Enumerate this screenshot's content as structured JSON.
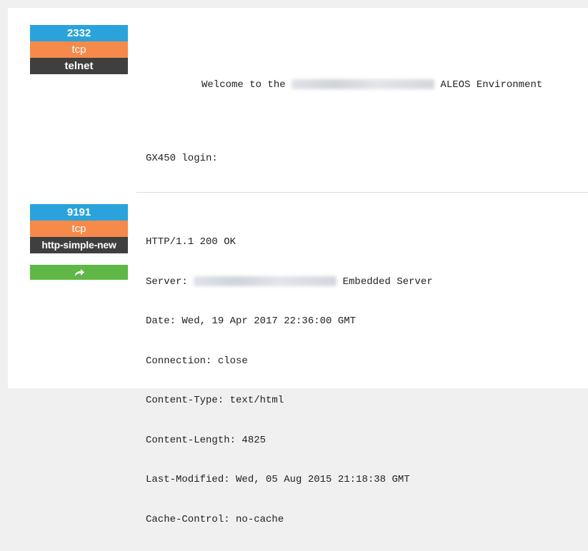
{
  "services": [
    {
      "port": "2332",
      "protocol": "tcp",
      "module": "telnet",
      "banner": {
        "welcome_prefix": "Welcome to the ",
        "welcome_suffix": " ALEOS Environment",
        "login_prompt": "GX450 login:"
      }
    },
    {
      "port": "9191",
      "protocol": "tcp",
      "module": "http-simple-new",
      "link_icon": "share-arrow-icon",
      "banner": {
        "status_line": "HTTP/1.1 200 OK",
        "server_prefix": "Server: ",
        "server_suffix": " Embedded Server",
        "date": "Date: Wed, 19 Apr 2017 22:36:00 GMT",
        "connection": "Connection: close",
        "content_type": "Content-Type: text/html",
        "content_length": "Content-Length: 4825",
        "last_modified": "Last-Modified: Wed, 05 Aug 2015 21:18:38 GMT",
        "cache_control": "Cache-Control: no-cache"
      }
    }
  ],
  "colors": {
    "port_badge": "#2aa3dc",
    "protocol_badge": "#f58a4b",
    "module_badge": "#3f3f3f",
    "link_button": "#5fb746"
  }
}
